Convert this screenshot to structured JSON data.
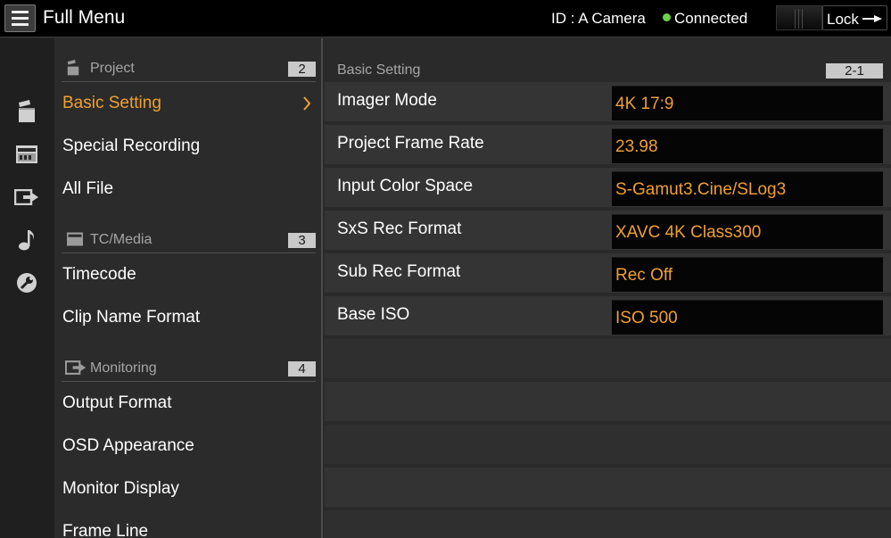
{
  "header": {
    "title": "Full Menu",
    "camera_id": "ID : A Camera",
    "status": "Connected",
    "status_color": "#6dd24a",
    "lock_label": "Lock",
    "menu_icon": "hamburger-icon",
    "lock_icon": "lock-arrow-icon"
  },
  "sidebar_icons": [
    {
      "name": "project-clapper-icon"
    },
    {
      "name": "tc-media-icon"
    },
    {
      "name": "monitoring-output-icon"
    },
    {
      "name": "audio-note-icon"
    },
    {
      "name": "maintenance-wrench-icon"
    }
  ],
  "categories": [
    {
      "label": "Project",
      "number": "2",
      "icon": "project-clapper-icon",
      "items": [
        "Basic Setting",
        "Special Recording",
        "All File"
      ]
    },
    {
      "label": "TC/Media",
      "number": "3",
      "icon": "tc-media-icon",
      "items": [
        "Timecode",
        "Clip Name Format"
      ]
    },
    {
      "label": "Monitoring",
      "number": "4",
      "icon": "monitoring-output-icon",
      "items": [
        "Output Format",
        "OSD Appearance",
        "Monitor Display",
        "Frame Line"
      ]
    }
  ],
  "selected_item": "Basic Setting",
  "settings": {
    "title": "Basic Setting",
    "number": "2-1",
    "rows": [
      {
        "label": "Imager Mode",
        "value": "4K 17:9"
      },
      {
        "label": "Project Frame Rate",
        "value": "23.98"
      },
      {
        "label": "Input Color Space",
        "value": "S-Gamut3.Cine/SLog3"
      },
      {
        "label": "SxS Rec Format",
        "value": "XAVC 4K Class300"
      },
      {
        "label": "Sub Rec Format",
        "value": "Rec Off"
      },
      {
        "label": "Base ISO",
        "value": "ISO 500"
      }
    ]
  },
  "colors": {
    "accent": "#f0a030",
    "background": "#2a2a2a",
    "titlebar": "#000000"
  }
}
